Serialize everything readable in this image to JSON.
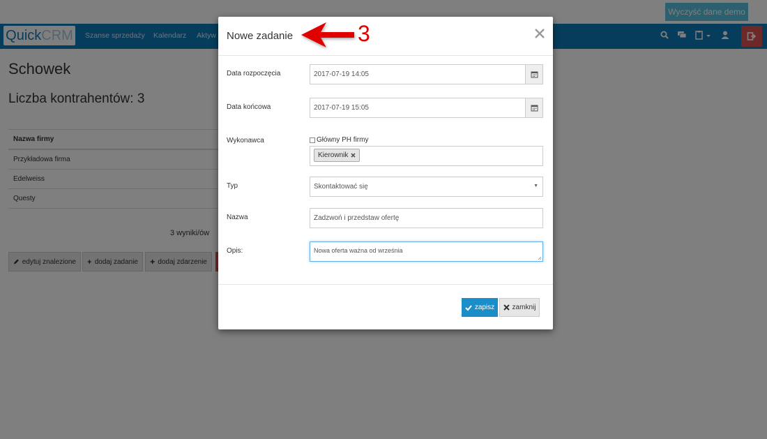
{
  "demo_button": "Wyczyść dane demo",
  "brand": {
    "part1": "Quick",
    "part2": "CRM"
  },
  "nav": {
    "items": [
      "Szanse sprzedaży",
      "Kalendarz",
      "Aktyw"
    ],
    "icons": [
      "search-icon",
      "chat-icon",
      "clipboard-icon",
      "user-icon",
      "logout-icon"
    ]
  },
  "page": {
    "title": "Schowek",
    "count_title": "Liczba kontrahentów: 3",
    "table": {
      "header": "Nazwa firmy",
      "rows": [
        "Przykładowa firma",
        "Edelweiss",
        "Questy"
      ]
    },
    "results": "3 wyniki/ów",
    "buttons": [
      "edytuj znalezione",
      "dodaj zadanie",
      "dodaj zdarzenie"
    ]
  },
  "modal": {
    "title": "Nowe zadanie",
    "fields": {
      "start_label": "Data rozpoczęcia",
      "start_value": "2017-07-19 14:05",
      "end_label": "Data końcowa",
      "end_value": "2017-07-19 15:05",
      "assignee_label": "Wykonawca",
      "main_ph_label": "Główny PH firmy",
      "assignee_tag": "Kierownik",
      "type_label": "Typ",
      "type_value": "Skontaktować się",
      "name_label": "Nazwa",
      "name_value": "Zadzwoń i przedstaw ofertę",
      "desc_label": "Opis:",
      "desc_value": "Nowa oferta ważna od września"
    },
    "save_label": "zapisz",
    "close_label": "zamknij"
  },
  "annotation": {
    "number": "3",
    "color": "#e00000"
  },
  "colors": {
    "navbar": "#0f7ab8",
    "primary": "#1a8ec8",
    "danger": "#d9534f",
    "info": "#5bc0de"
  }
}
